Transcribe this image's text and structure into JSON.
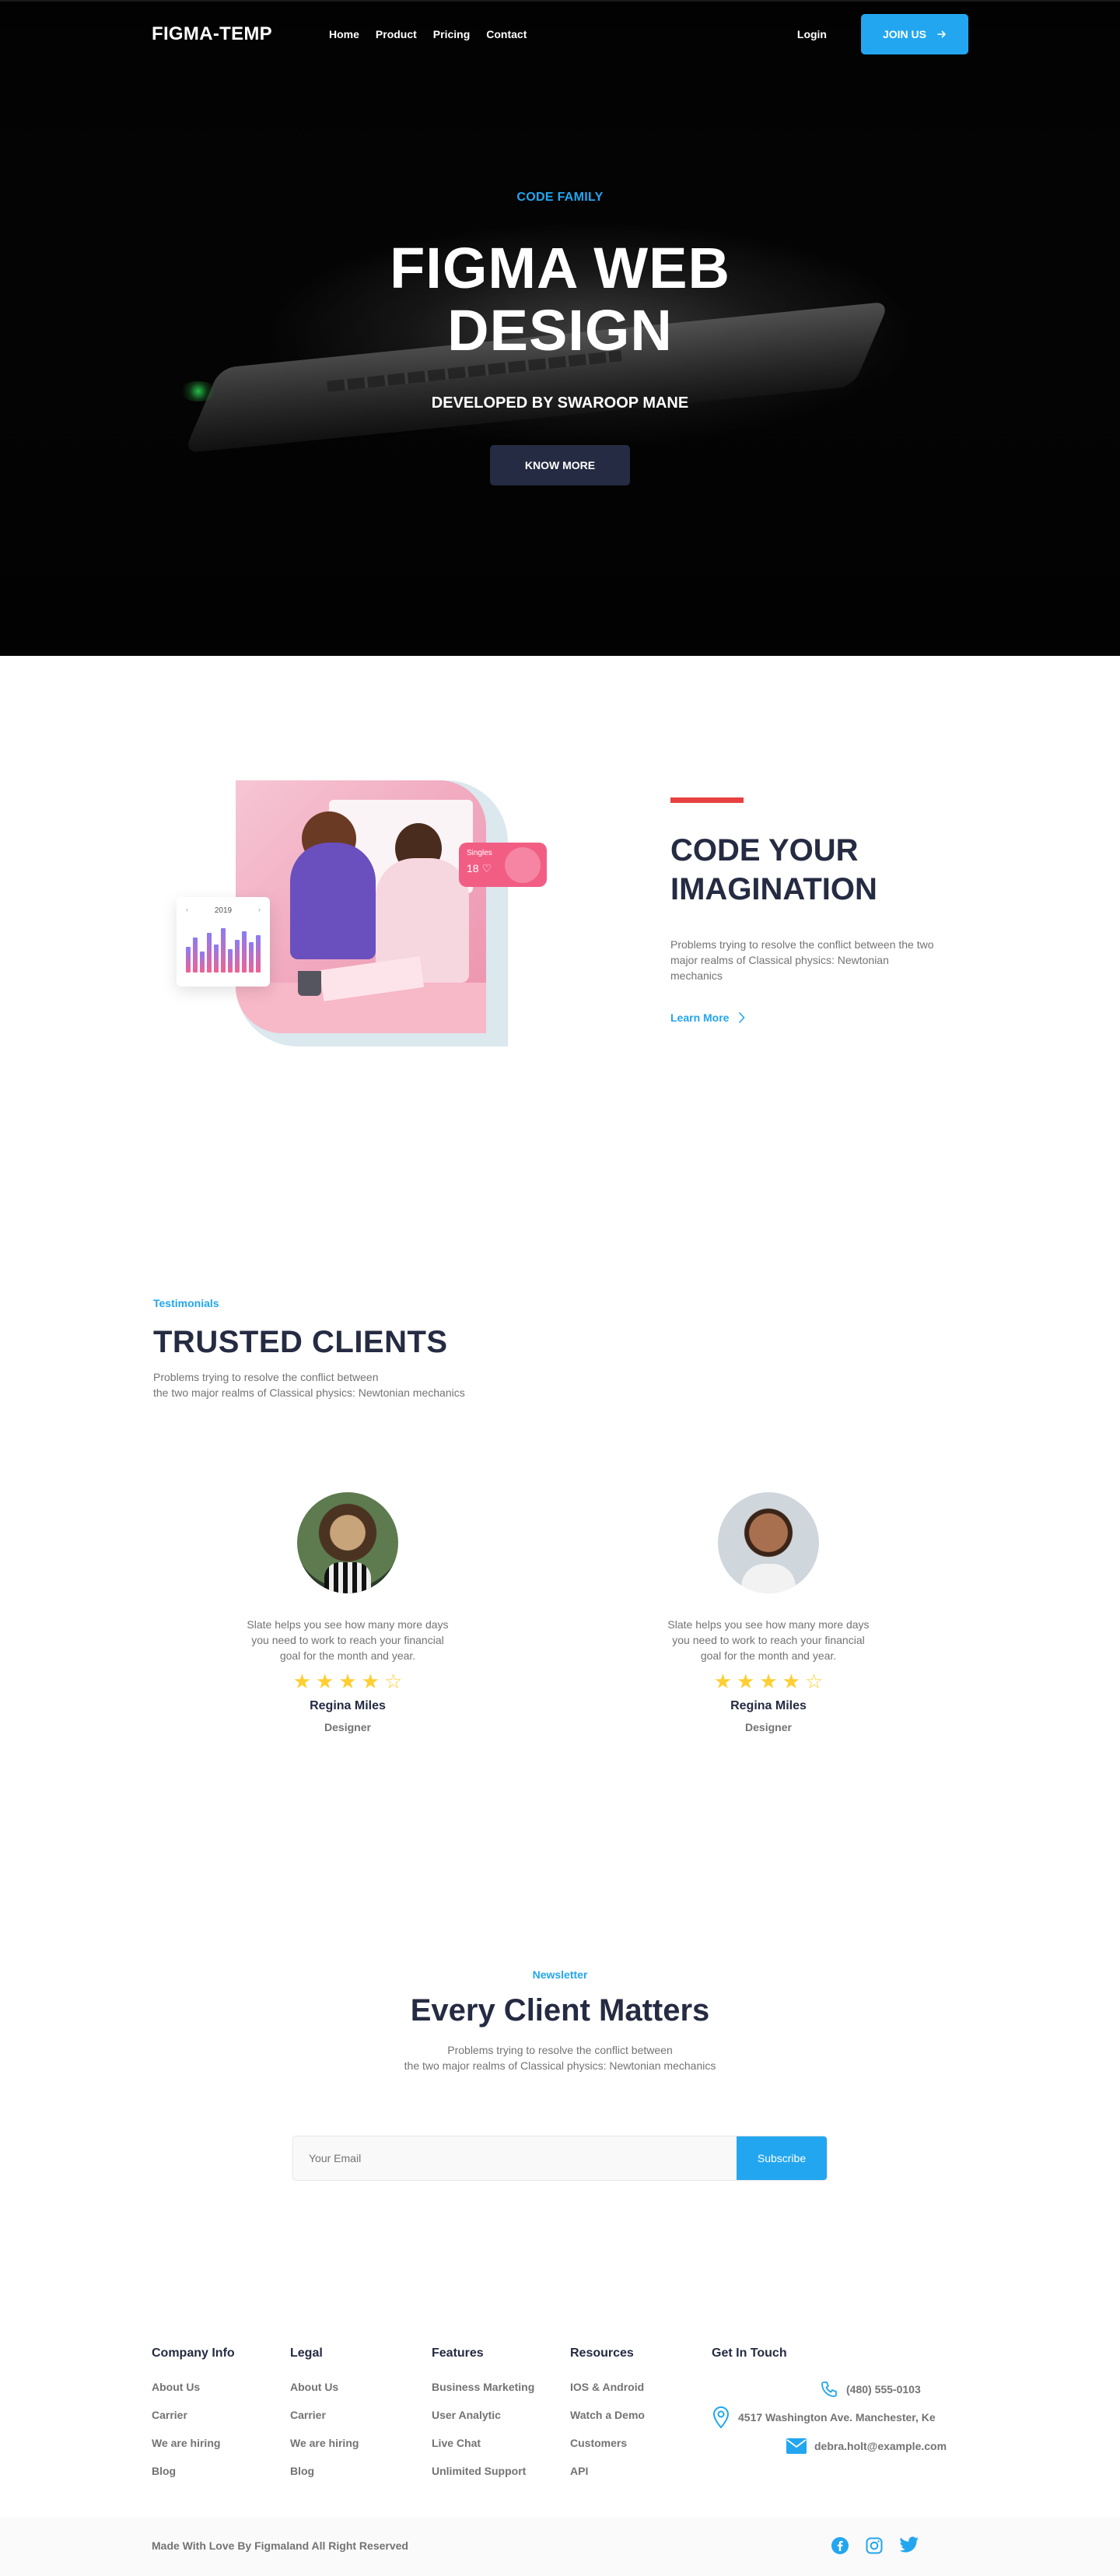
{
  "nav": {
    "brand": "FIGMA-TEMP",
    "links": [
      "Home",
      "Product",
      "Pricing",
      "Contact"
    ],
    "login": "Login",
    "join": "JOIN US"
  },
  "hero": {
    "kicker": "CODE FAMILY",
    "title_line1": "FIGMA WEB",
    "title_line2": "DESIGN",
    "subtitle": "DEVELOPED BY SWAROOP MANE",
    "button": "KNOW MORE"
  },
  "feature": {
    "chart_year": "2019",
    "singles_label": "Singles",
    "singles_value": "18",
    "title_line1": "CODE YOUR",
    "title_line2": "IMAGINATION",
    "description": "Problems trying to resolve the conflict between the two major realms of Classical physics: Newtonian mechanics",
    "link": "Learn More"
  },
  "testimonials": {
    "kicker": "Testimonials",
    "title": "TRUSTED CLIENTS",
    "desc_line1": "Problems trying to resolve the conflict between",
    "desc_line2": "the two major realms of Classical physics: Newtonian mechanics",
    "items": [
      {
        "quote": "Slate helps you see how many more days you need to work to reach your financial goal for the month and year.",
        "name": "Regina Miles",
        "role": "Designer",
        "rating": 4
      },
      {
        "quote": "Slate helps you see how many more days you need to work to reach your financial goal for the month and year.",
        "name": "Regina Miles",
        "role": "Designer",
        "rating": 4
      }
    ]
  },
  "newsletter": {
    "kicker": "Newsletter",
    "title": "Every Client Matters",
    "desc_line1": "Problems trying to resolve the conflict between",
    "desc_line2": "the two major realms of Classical physics: Newtonian mechanics",
    "placeholder": "Your Email",
    "button": "Subscribe"
  },
  "footer": {
    "columns": [
      {
        "title": "Company Info",
        "links": [
          "About Us",
          "Carrier",
          "We are hiring",
          "Blog"
        ]
      },
      {
        "title": "Legal",
        "links": [
          "About Us",
          "Carrier",
          "We are hiring",
          "Blog"
        ]
      },
      {
        "title": "Features",
        "links": [
          "Business Marketing",
          "User Analytic",
          "Live Chat",
          "Unlimited Support"
        ]
      },
      {
        "title": "Resources",
        "links": [
          "IOS & Android",
          "Watch a Demo",
          "Customers",
          "API"
        ]
      }
    ],
    "contact_title": "Get In Touch",
    "phone": "(480) 555-0103",
    "address": "4517 Washington Ave. Manchester, Ke",
    "email": "debra.holt@example.com",
    "copyright": "Made With Love By Figmaland All Right Reserved",
    "socials": [
      "facebook-icon",
      "instagram-icon",
      "twitter-icon"
    ]
  },
  "colors": {
    "accent": "#23a6f0",
    "dark": "#252b42",
    "muted": "#737373",
    "red": "#e74040",
    "star": "#ffce31"
  }
}
